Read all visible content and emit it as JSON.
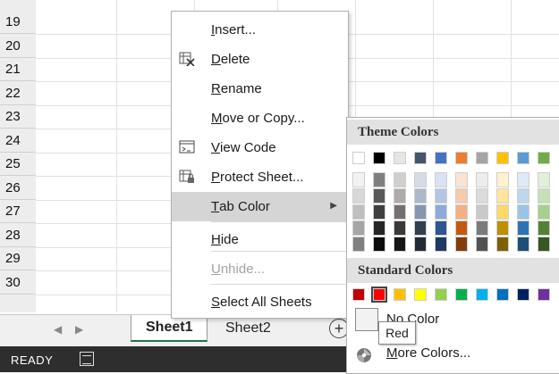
{
  "rows": [
    "19",
    "20",
    "21",
    "22",
    "23",
    "24",
    "25",
    "26",
    "27",
    "28",
    "29",
    "30"
  ],
  "sheet_tabs": [
    {
      "label": "Sheet1",
      "active": true
    },
    {
      "label": "Sheet2",
      "active": false
    }
  ],
  "tab_nav": {
    "prev": "◀",
    "next": "▶"
  },
  "add_sheet": "+",
  "status": {
    "ready": "READY"
  },
  "context_menu": {
    "items": [
      {
        "pre": "",
        "ul": "I",
        "post": "nsert...",
        "icon": "",
        "disabled": false
      },
      {
        "pre": "",
        "ul": "D",
        "post": "elete",
        "icon": "delete-sheet-icon",
        "disabled": false
      },
      {
        "pre": "",
        "ul": "R",
        "post": "ename",
        "icon": "",
        "disabled": false
      },
      {
        "pre": "",
        "ul": "M",
        "post": "ove or Copy...",
        "icon": "",
        "disabled": false
      },
      {
        "pre": "",
        "ul": "V",
        "post": "iew Code",
        "icon": "view-code-icon",
        "disabled": false
      },
      {
        "pre": "",
        "ul": "P",
        "post": "rotect Sheet...",
        "icon": "protect-sheet-icon",
        "disabled": false
      },
      {
        "pre": "",
        "ul": "T",
        "post": "ab Color",
        "icon": "",
        "disabled": false,
        "submenu": true,
        "hover": true
      },
      {
        "pre": "",
        "ul": "H",
        "post": "ide",
        "icon": "",
        "disabled": false
      },
      {
        "pre": "",
        "ul": "U",
        "post": "nhide...",
        "icon": "",
        "disabled": true
      },
      {
        "pre": "",
        "ul": "S",
        "post": "elect All Sheets",
        "icon": "",
        "disabled": false
      }
    ],
    "submenu_arrow": "▶"
  },
  "palette": {
    "theme_heading": "Theme Colors",
    "standard_heading": "Standard Colors",
    "theme_top": [
      "#ffffff",
      "#000000",
      "#e7e6e6",
      "#44546a",
      "#4472c4",
      "#ed7d31",
      "#a5a5a5",
      "#ffc000",
      "#5b9bd5",
      "#70ad47"
    ],
    "theme_shades": [
      [
        "#f2f2f2",
        "#7f7f7f",
        "#d0cece",
        "#d6dce4",
        "#d9e2f3",
        "#fbe4d5",
        "#ededed",
        "#fff2cc",
        "#deeaf6",
        "#e2efd9"
      ],
      [
        "#d8d8d8",
        "#595959",
        "#aeaaaa",
        "#adb9ca",
        "#b4c6e7",
        "#f7caac",
        "#dbdbdb",
        "#fee599",
        "#bdd7ee",
        "#c5e0b3"
      ],
      [
        "#bfbfbf",
        "#3f3f3f",
        "#757070",
        "#8496b0",
        "#8eaadb",
        "#f4b083",
        "#c9c9c9",
        "#ffd965",
        "#9cc3e5",
        "#a8d08d"
      ],
      [
        "#a5a5a5",
        "#262626",
        "#3a3838",
        "#323f4f",
        "#2f5496",
        "#c45911",
        "#7b7b7b",
        "#bf9000",
        "#2e74b5",
        "#538135"
      ],
      [
        "#7f7f7f",
        "#0c0c0c",
        "#171616",
        "#222a35",
        "#1f3864",
        "#833c0b",
        "#525252",
        "#7f6000",
        "#1f4e79",
        "#375623"
      ]
    ],
    "standard": [
      "#c00000",
      "#ff0000",
      "#ffc000",
      "#ffff00",
      "#92d050",
      "#00b050",
      "#00b0f0",
      "#0070c0",
      "#002060",
      "#7030a0"
    ],
    "selected_standard_index": 1,
    "no_color": {
      "ul": "N",
      "post": "o Color"
    },
    "more_colors": {
      "ul": "M",
      "post": "ore Colors..."
    }
  },
  "tooltip": "Red"
}
